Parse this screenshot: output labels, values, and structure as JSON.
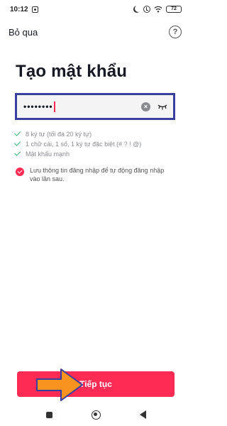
{
  "status_bar": {
    "time": "10:12",
    "battery": "72"
  },
  "top_bar": {
    "skip_label": "Bỏ qua",
    "help_glyph": "?"
  },
  "title": "Tạo mật khẩu",
  "password_field": {
    "value": "••••••••"
  },
  "requirements": [
    "8 ký tự (tối đa 20 ký tự)",
    "1 chữ cái, 1 số, 1 ký tự đặc biệt (# ? ! @)",
    "Mật khẩu mạnh"
  ],
  "save_login": {
    "label": "Lưu thông tin đăng nhập để tự động đăng nhập vào lần sau.",
    "checked": true
  },
  "continue_button": {
    "label": "Tiếp tục"
  },
  "colors": {
    "accent": "#fe2c55",
    "success": "#2bb56e",
    "highlight_border": "#3a3f9e",
    "annotation_arrow": "#f7931e"
  },
  "icons": [
    "alarm-icon",
    "moon-icon",
    "wifi-icon",
    "battery-icon",
    "help-icon",
    "clear-icon",
    "eye-closed-icon",
    "check-icon",
    "checkbox-icon",
    "arrow-annotation-icon",
    "nav-recents-icon",
    "nav-home-icon",
    "nav-back-icon"
  ]
}
